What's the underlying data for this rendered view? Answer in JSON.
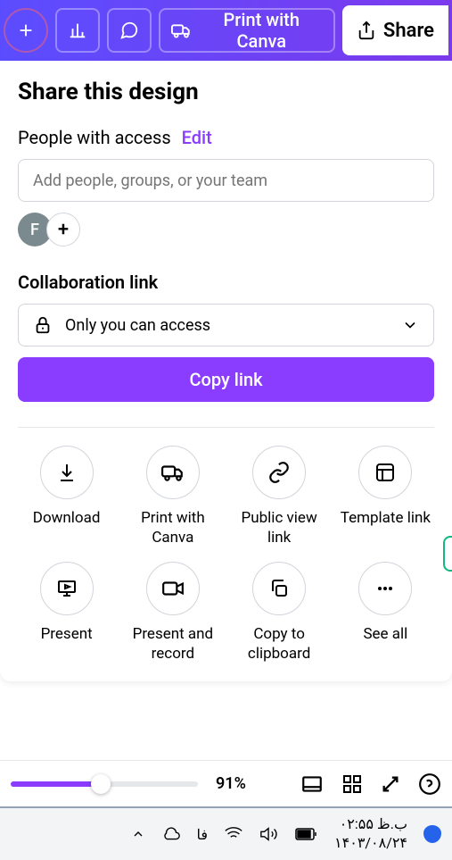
{
  "toolbar": {
    "print_label": "Print with Canva",
    "share_label": "Share"
  },
  "share": {
    "title": "Share this design",
    "access_label": "People with access",
    "edit_label": "Edit",
    "input_placeholder": "Add people, groups, or your team",
    "avatar_initial": "F",
    "collab_title": "Collaboration link",
    "access_option": "Only you can access",
    "copy_button": "Copy link"
  },
  "actions": [
    {
      "label": "Download"
    },
    {
      "label": "Print with Canva"
    },
    {
      "label": "Public view link"
    },
    {
      "label": "Template link"
    },
    {
      "label": "Present"
    },
    {
      "label": "Present and record"
    },
    {
      "label": "Copy to clipboard"
    },
    {
      "label": "See all"
    }
  ],
  "bottom": {
    "zoom": "91%"
  },
  "taskbar": {
    "lang": "فا",
    "time": "ب.ظ ۰۲:۵۵",
    "date": "۱۴۰۳/۰۸/۲۴"
  }
}
